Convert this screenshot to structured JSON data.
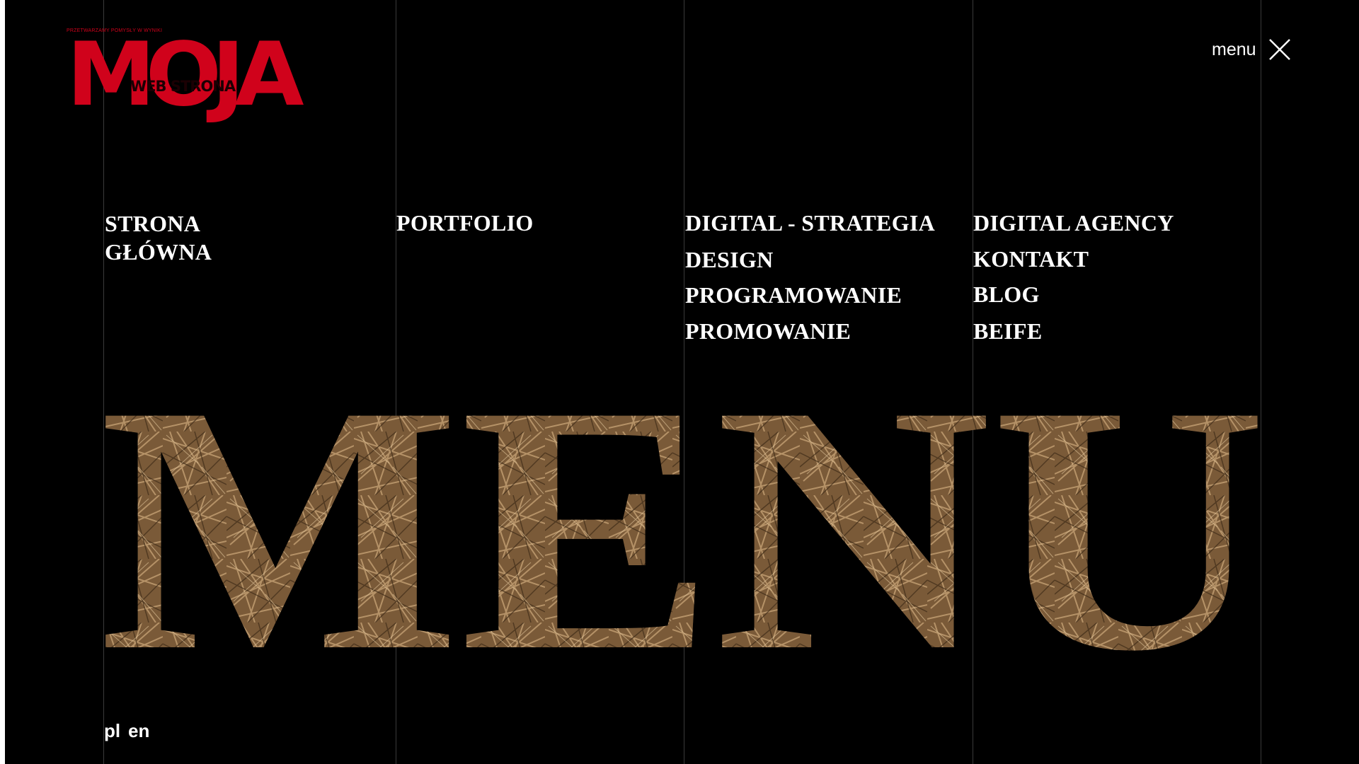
{
  "logo": {
    "tagline": "PRZETWARZAMY POMYSŁY W WYNIKI",
    "main": "MOJA",
    "sub": "WEB STRONA"
  },
  "menu_toggle": {
    "label": "menu",
    "icon": "close-icon"
  },
  "nav": {
    "col1": {
      "home": "STRONA GŁÓWNA"
    },
    "col2": {
      "portfolio": "PORTFOLIO"
    },
    "col3": {
      "strategy": "DIGITAL - STRATEGIA",
      "design": "DESIGN",
      "programming": "PROGRAMOWANIE",
      "promotion": "PROMOWANIE"
    },
    "col4": {
      "agency": "DIGITAL AGENCY",
      "contact": "KONTAKT",
      "blog": "BLOG",
      "beife": "BEIFE"
    }
  },
  "hero_word": "MENU",
  "languages": [
    "pl",
    "en"
  ],
  "colors": {
    "background": "#000000",
    "brand_red": "#d0021b",
    "text": "#ffffff",
    "column_lines": "#3a3a3a",
    "letter_fill_straw": "#8a6a44",
    "letter_fill_birch": "#d6c3ae"
  }
}
